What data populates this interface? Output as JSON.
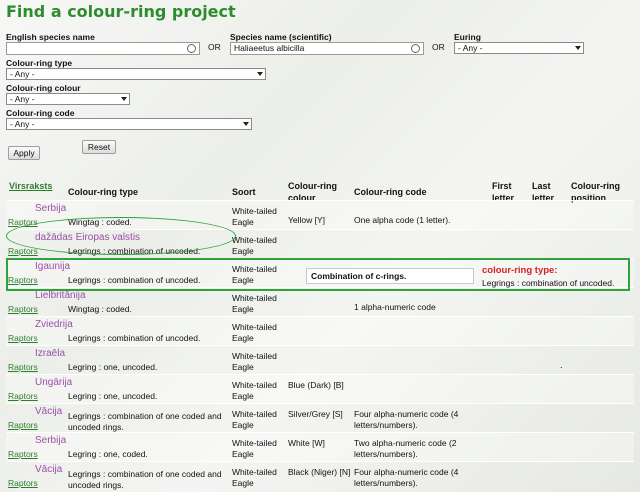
{
  "page_title": "Find a colour-ring project",
  "form": {
    "english_label": "English species name",
    "english_value": "",
    "or_text": "OR",
    "scientific_label": "Species name (scientific)",
    "scientific_value": "Haliaeetus albicilla",
    "euring_label": "Euring",
    "euring_value": "- Any -",
    "ring_type_label": "Colour-ring type",
    "ring_type_value": "- Any -",
    "ring_colour_label": "Colour-ring colour",
    "ring_colour_value": "- Any -",
    "ring_code_label": "Colour-ring code",
    "ring_code_value": "- Any -",
    "apply_label": "Apply",
    "reset_label": "Reset"
  },
  "table": {
    "headers": {
      "virsraksts": "Virsraksts",
      "type": "Colour-ring type",
      "soort": "Soort",
      "colour": "Colour-ring colour",
      "code": "Colour-ring code",
      "first": "First letter",
      "last": "Last letter",
      "position": "Colour-ring position"
    },
    "link_text": "Raptors",
    "rows": [
      {
        "country": "Serbija",
        "type": "Wingtag : coded.",
        "species": "White-tailed Eagle",
        "colour": "Yellow [Y]",
        "code": "One alpha code (1 letter)."
      },
      {
        "country": "dažādas Eiropas valstis",
        "type": "Legrings : combination of uncoded.",
        "species": "White-tailed Eagle",
        "colour": "",
        "code": ""
      },
      {
        "country": "Igaunija",
        "type": "Legrings : combination of uncoded.",
        "species": "White-tailed Eagle",
        "colour": "",
        "code": ""
      },
      {
        "country": "Lielbritānija",
        "type": "Wingtag : coded.",
        "species": "White-tailed Eagle",
        "colour": "",
        "code": "1 alpha-numeric code"
      },
      {
        "country": "Zviedrija",
        "type": "Legrings : combination of uncoded.",
        "species": "White-tailed Eagle",
        "colour": "",
        "code": ""
      },
      {
        "country": "Izraēla",
        "type": "Legring : one, uncoded.",
        "species": "White-tailed Eagle",
        "colour": "",
        "code": ""
      },
      {
        "country": "Ungārija",
        "type": "Legring : one, uncoded.",
        "species": "White-tailed Eagle",
        "colour": "Blue (Dark) [B]",
        "code": ""
      },
      {
        "country": "Vācija",
        "type": "Legrings : combination of one coded and uncoded rings.",
        "species": "White-tailed Eagle",
        "colour": "Silver/Grey [S]",
        "code": "Four alpha-numeric code (4 letters/numbers)."
      },
      {
        "country": "Serbija",
        "type": "Legring : one, coded.",
        "species": "White-tailed Eagle",
        "colour": "White [W]",
        "code": "Two alpha-numeric code (2 letters/numbers)."
      },
      {
        "country": "Vācija",
        "type": "Legrings : combination of one coded and uncoded rings.",
        "species": "White-tailed Eagle",
        "colour": "Black (Niger) [N]",
        "code": "Four alpha-numeric code (4 letters/numbers)."
      }
    ],
    "dot": "."
  },
  "tooltip": {
    "text": "Combination of c-rings.",
    "title": "colour-ring type:",
    "value": "Legrings : combination of uncoded."
  },
  "colors": {
    "accent": "#2e8b2e",
    "country": "#9b4fa8",
    "highlight": "#2fa23a",
    "alert": "#d12222"
  }
}
